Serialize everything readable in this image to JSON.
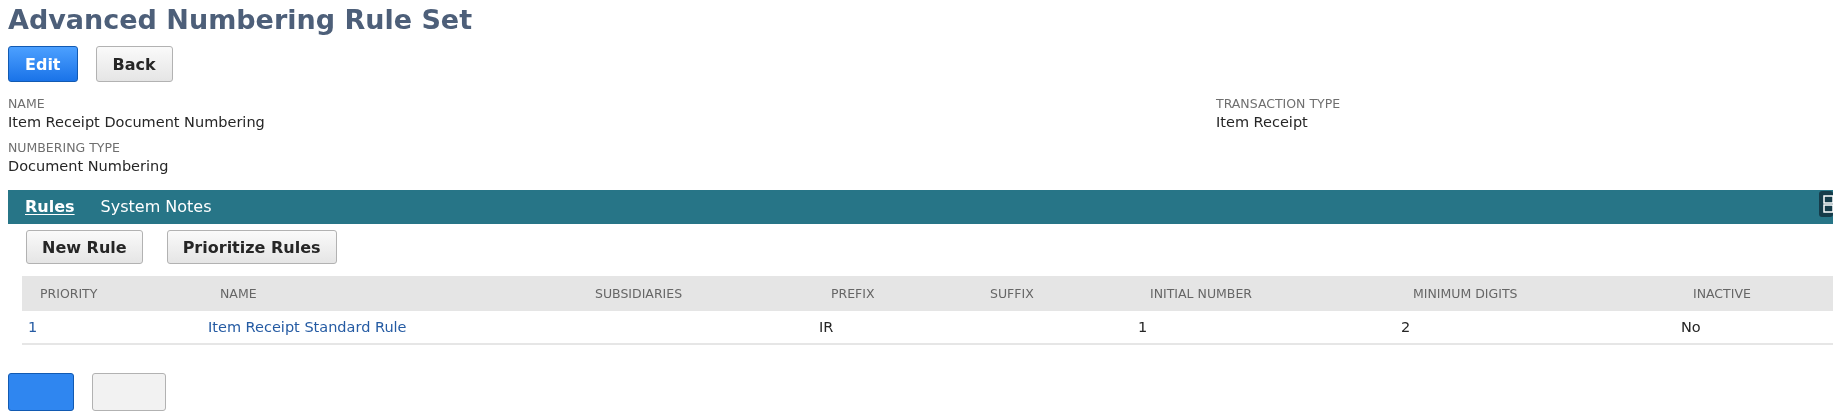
{
  "title": "Advanced Numbering Rule Set",
  "top_buttons": [
    {
      "label": "Edit",
      "kind": "primary"
    },
    {
      "label": "Back",
      "kind": "secondary"
    }
  ],
  "fields_left": [
    {
      "label": "NAME",
      "value": "Item Receipt Document Numbering"
    },
    {
      "label": "NUMBERING TYPE",
      "value": "Document Numbering"
    }
  ],
  "fields_right": [
    {
      "label": "TRANSACTION TYPE",
      "value": "Item Receipt"
    }
  ],
  "tabs": [
    {
      "label": "Rules",
      "selected": true
    },
    {
      "label": "System Notes",
      "selected": false
    }
  ],
  "rule_buttons": [
    "New Rule",
    "Prioritize Rules"
  ],
  "table": {
    "columns": [
      "PRIORITY",
      "NAME",
      "SUBSIDIARIES",
      "PREFIX",
      "SUFFIX",
      "INITIAL NUMBER",
      "MINIMUM DIGITS",
      "INACTIVE"
    ],
    "rows": [
      {
        "cells": [
          "1",
          "Item Receipt Standard Rule",
          "",
          "IR",
          "",
          "1",
          "2",
          "No"
        ]
      }
    ]
  },
  "bottom_buttons": [
    {
      "kind": "primary"
    },
    {
      "kind": "secondary"
    }
  ]
}
